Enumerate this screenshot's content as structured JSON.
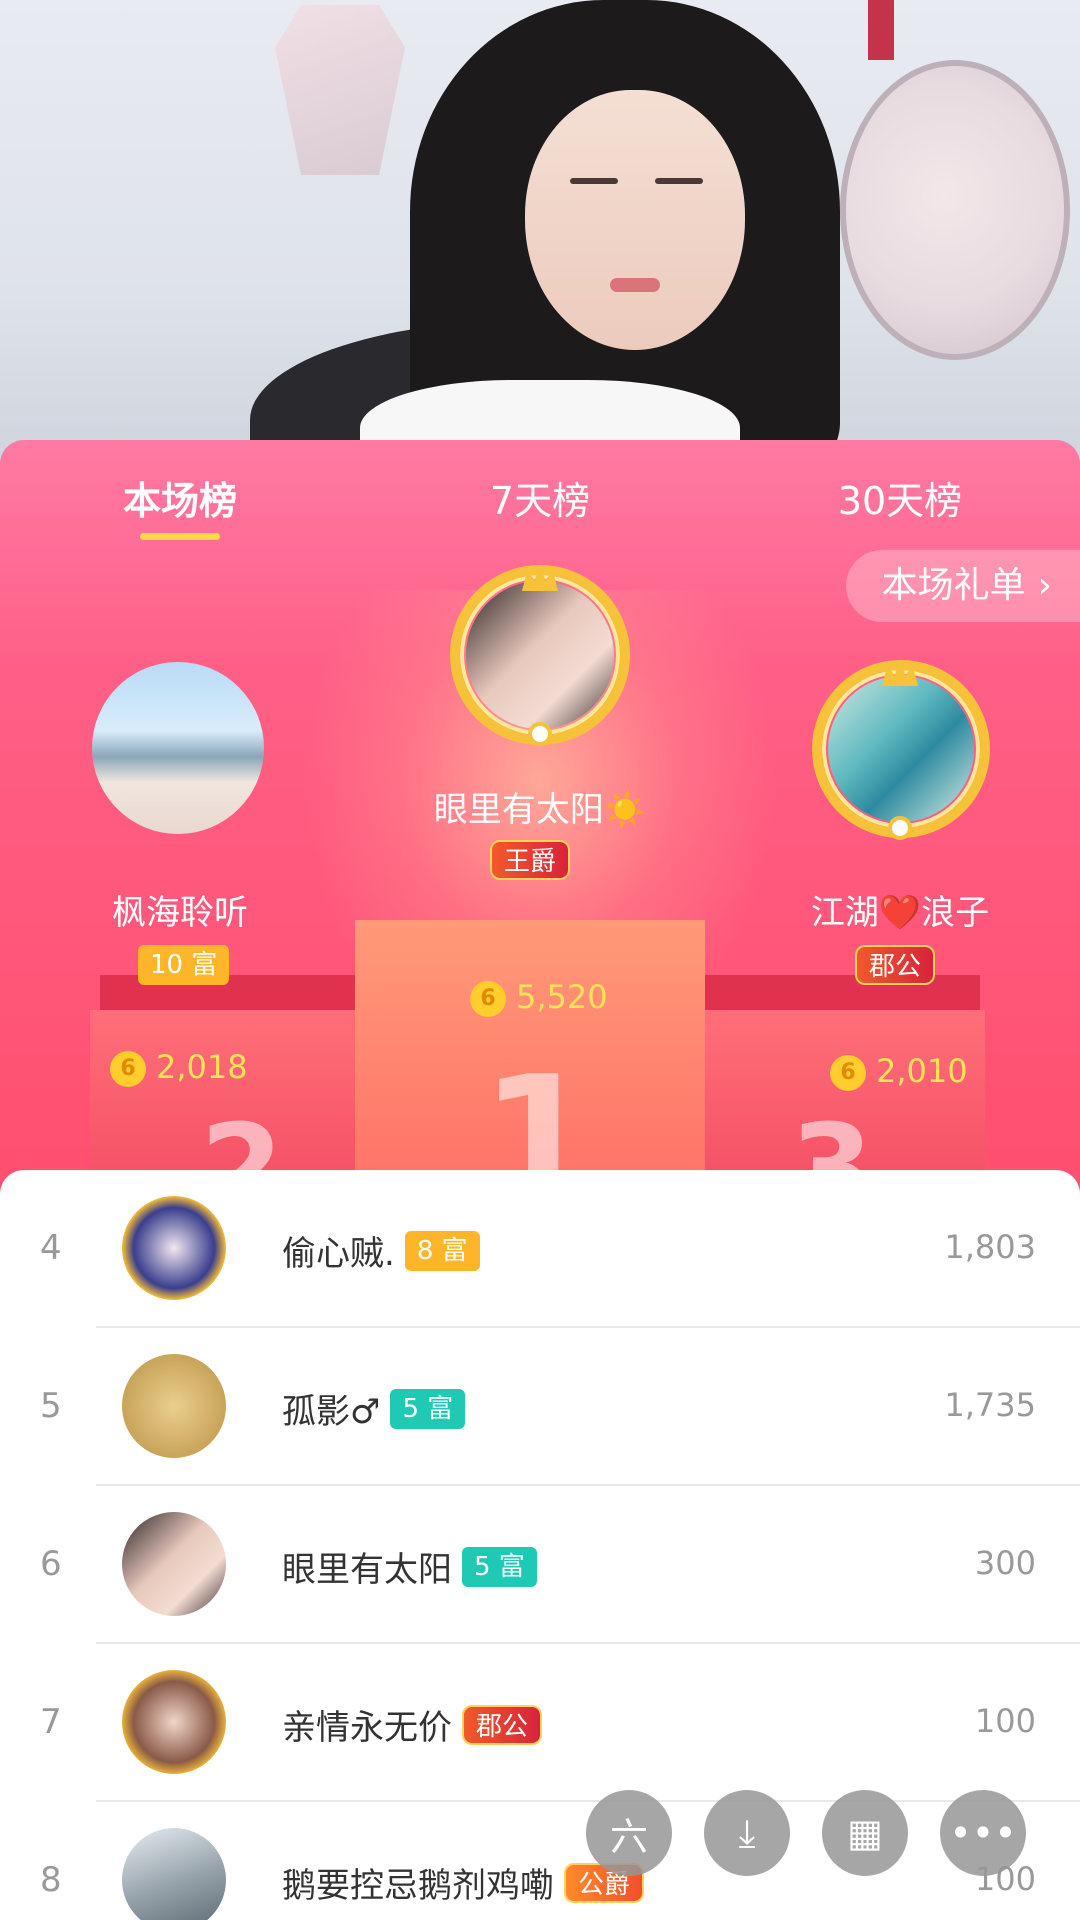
{
  "tabs": [
    {
      "label": "本场榜",
      "active": true
    },
    {
      "label": "7天榜",
      "active": false
    },
    {
      "label": "30天榜",
      "active": false
    }
  ],
  "gift_link": {
    "label": "本场礼单",
    "icon": "chevron-right-icon"
  },
  "podium": {
    "first": {
      "rank": "1",
      "name": "眼里有太阳☀️",
      "badge": "王爵",
      "score": "5,520"
    },
    "second": {
      "rank": "2",
      "name": "枫海聆听",
      "badge": "10 富",
      "score": "2,018"
    },
    "third": {
      "rank": "3",
      "name": "江湖❤️浪子",
      "badge": "郡公",
      "score": "2,010"
    }
  },
  "coin_glyph": "6",
  "list": [
    {
      "rank": "4",
      "name": "偷心贼.",
      "badge": "8 富",
      "badge_style": "orange",
      "value": "1,803"
    },
    {
      "rank": "5",
      "name": "孤影♂",
      "badge": "5 富",
      "badge_style": "teal",
      "value": "1,735"
    },
    {
      "rank": "6",
      "name": "眼里有太阳",
      "badge": "5 富",
      "badge_style": "teal",
      "value": "300"
    },
    {
      "rank": "7",
      "name": "亲情永无价",
      "badge": "郡公",
      "badge_style": "red",
      "value": "100"
    },
    {
      "rank": "8",
      "name": "鹅要控忌鹅剂鸡嘞",
      "badge": "公爵",
      "badge_style": "gold",
      "value": "100"
    }
  ],
  "fabs": [
    {
      "name": "liuliu-logo-icon",
      "glyph": "六"
    },
    {
      "name": "download-icon",
      "glyph": "⤓"
    },
    {
      "name": "grid-icon",
      "glyph": "▦"
    },
    {
      "name": "more-icon",
      "glyph": "•••"
    }
  ],
  "colors": {
    "panel_pink": "#ff5f87",
    "accent_yellow": "#ffd84a",
    "teal": "#1fc9b4",
    "orange": "#ffb52a"
  }
}
